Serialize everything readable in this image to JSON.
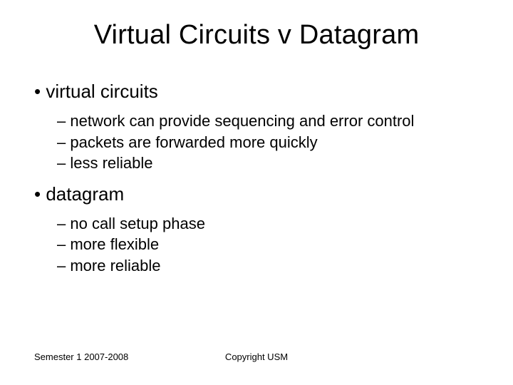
{
  "title": "Virtual Circuits v Datagram",
  "bullets": [
    {
      "label": "virtual circuits",
      "items": [
        "network can provide sequencing and error control",
        "packets are forwarded more quickly",
        "less reliable"
      ]
    },
    {
      "label": "datagram",
      "items": [
        "no call setup phase",
        "more flexible",
        "more reliable"
      ]
    }
  ],
  "footer": {
    "left": "Semester 1 2007-2008",
    "center": "Copyright USM"
  }
}
